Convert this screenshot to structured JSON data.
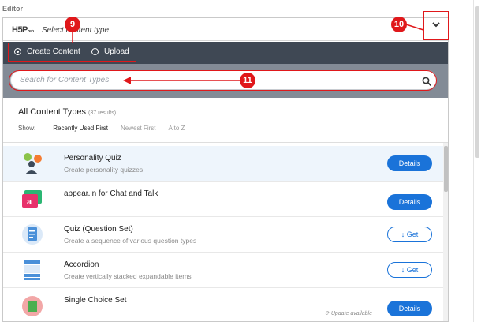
{
  "editor_label": "Editor",
  "selector": {
    "logo_main": "H5P",
    "logo_sub": "hub",
    "select_text": "Select content type",
    "toggle_icon": "chevron-down-icon"
  },
  "mode_options": [
    {
      "label": "Create Content",
      "selected": true
    },
    {
      "label": "Upload",
      "selected": false
    }
  ],
  "search": {
    "value": "",
    "placeholder": "Search for Content Types",
    "icon": "search-icon"
  },
  "types_header": {
    "title": "All Content Types",
    "count": "(37 results)"
  },
  "sort": {
    "label": "Show:",
    "options": [
      "Recently Used First",
      "Newest First",
      "A to Z"
    ],
    "active": "Recently Used First"
  },
  "content_types": [
    {
      "title": "Personality Quiz",
      "description": "Create personality quizzes",
      "action": "Details",
      "icon": "personality-quiz-icon"
    },
    {
      "title": "appear.in for Chat and Talk",
      "description": "",
      "action": "Details",
      "icon": "appear-in-icon"
    },
    {
      "title": "Quiz (Question Set)",
      "description": "Create a sequence of various question types",
      "action": "Get",
      "icon": "quiz-icon"
    },
    {
      "title": "Accordion",
      "description": "Create vertically stacked expandable items",
      "action": "Get",
      "icon": "accordion-icon"
    },
    {
      "title": "Single Choice Set",
      "description": "",
      "action": "Details",
      "note": "Update available",
      "icon": "single-choice-icon"
    }
  ],
  "annotations": [
    {
      "label": "9"
    },
    {
      "label": "10"
    },
    {
      "label": "11"
    }
  ],
  "colors": {
    "dark_bar": "#3f4854",
    "search_bg": "#838b96",
    "primary": "#1a73d9",
    "annotation": "#e0181b"
  }
}
